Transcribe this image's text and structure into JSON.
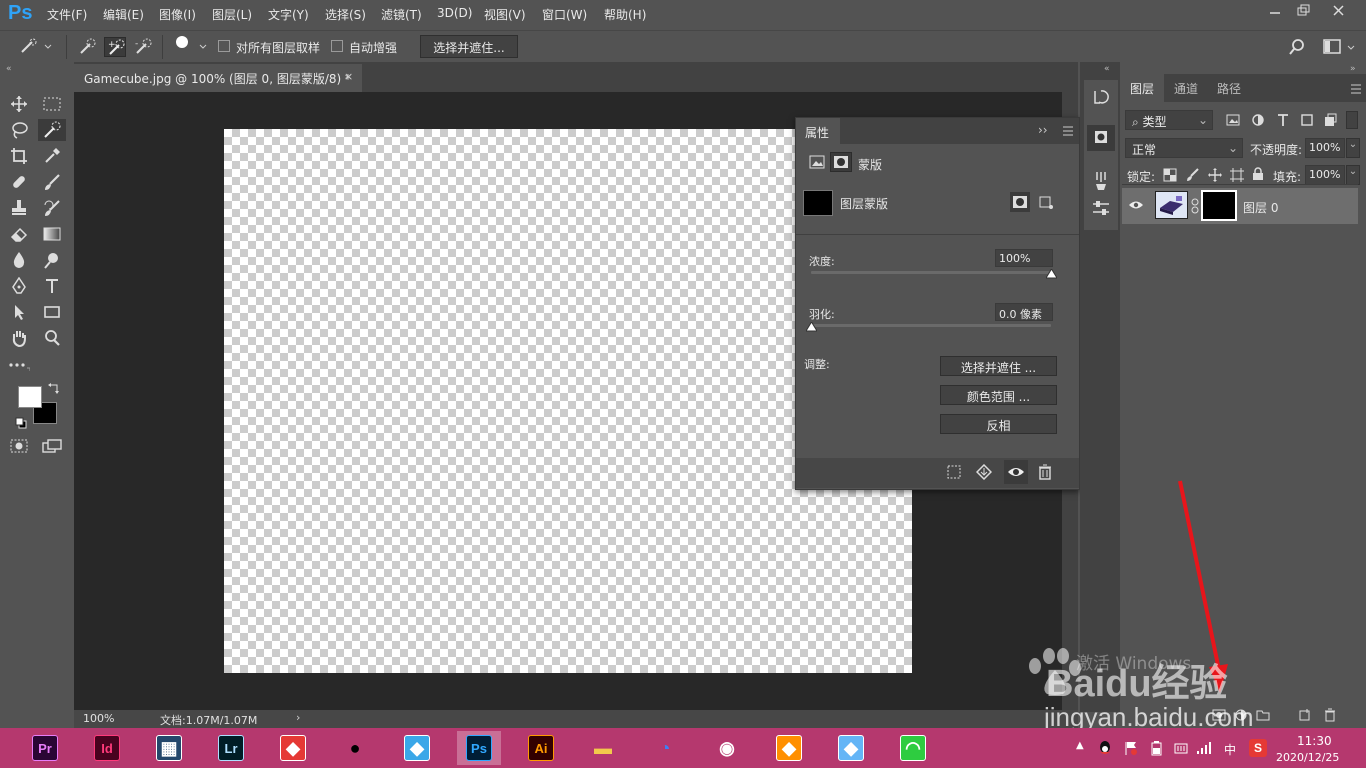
{
  "app": {
    "logo": "Ps"
  },
  "menu": [
    "文件(F)",
    "编辑(E)",
    "图像(I)",
    "图层(L)",
    "文字(Y)",
    "选择(S)",
    "滤镜(T)",
    "3D(D)",
    "视图(V)",
    "窗口(W)",
    "帮助(H)"
  ],
  "options": {
    "brush_size": "15",
    "sample_all_layers": "对所有图层取样",
    "auto_enhance": "自动增强",
    "select_mask_button": "选择并遮住..."
  },
  "document": {
    "tab_title": "Gamecube.jpg @ 100% (图层 0, 图层蒙版/8) *",
    "zoom": "100%",
    "doc_size": "文档:1.07M/1.07M"
  },
  "properties": {
    "title": "属性",
    "mask_type": "蒙版",
    "layer_mask_label": "图层蒙版",
    "density_label": "浓度:",
    "density_value": "100%",
    "density_fraction": 1.0,
    "feather_label": "羽化:",
    "feather_value": "0.0 像素",
    "feather_fraction": 0.0,
    "adjust_label": "调整:",
    "buttons": [
      "选择并遮住 ...",
      "颜色范围 ...",
      "反相"
    ]
  },
  "layers_panel": {
    "tabs": [
      "图层",
      "通道",
      "路径"
    ],
    "filter_kind": "类型",
    "blend_mode": "正常",
    "opacity_label": "不透明度:",
    "opacity_value": "100%",
    "lock_label": "锁定:",
    "fill_label": "填充:",
    "fill_value": "100%",
    "layers": [
      {
        "name": "图层 0",
        "visible": true
      }
    ]
  },
  "taskbar": {
    "apps": [
      {
        "label": "Pr",
        "color": "#e77cf8",
        "bg": "#2a0634"
      },
      {
        "label": "Id",
        "color": "#ff3a7b",
        "bg": "#49021f"
      },
      {
        "label": "",
        "icon": "film-icon",
        "color": "#ffffff",
        "bg": "#24476b"
      },
      {
        "label": "Lr",
        "color": "#addfff",
        "bg": "#001d26"
      },
      {
        "label": "",
        "icon": "app-icon",
        "color": "#ffffff",
        "bg": "#e53935"
      },
      {
        "label": "",
        "icon": "qq-icon",
        "color": "#000000",
        "bg": "transparent"
      },
      {
        "label": "",
        "icon": "app-icon",
        "color": "#ffffff",
        "bg": "#3aa7e8"
      },
      {
        "label": "Ps",
        "color": "#31a8ff",
        "bg": "#001e36"
      },
      {
        "label": "Ai",
        "color": "#ff9a00",
        "bg": "#330000"
      },
      {
        "label": "",
        "icon": "folder-icon",
        "color": "#f2c94c",
        "bg": "transparent"
      },
      {
        "label": "",
        "icon": "browser-icon",
        "color": "#3b82f6",
        "bg": "transparent"
      },
      {
        "label": "",
        "icon": "chrome-icon",
        "color": "#ffffff",
        "bg": "transparent"
      },
      {
        "label": "",
        "icon": "app-icon",
        "color": "#ffffff",
        "bg": "#ff8f00"
      },
      {
        "label": "",
        "icon": "app-icon",
        "color": "#ffffff",
        "bg": "#64b5f6"
      },
      {
        "label": "",
        "icon": "wifi-icon",
        "color": "#ffffff",
        "bg": "#2ecc40"
      }
    ],
    "tray_ime": "中",
    "time": "11:30",
    "date": "2020/12/25"
  },
  "watermark": {
    "activation_line": "激活 Windows",
    "brand": "Baidu经验",
    "url": "jingyan.baidu.com"
  },
  "colors": {
    "panel_bg": "#535353",
    "panel_dark": "#424242",
    "canvas_bg": "#282828",
    "taskbar": "#b5386e",
    "annotation_arrow": "#e8151b"
  }
}
